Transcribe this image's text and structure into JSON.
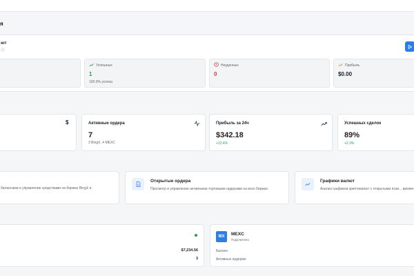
{
  "header": {
    "title_fragment": "я"
  },
  "bot_panel": {
    "title_fragment": "ют",
    "stats": [
      {
        "label": "Успешных",
        "value": "1",
        "sub": "100.0% успеха"
      },
      {
        "label": "Неудачных",
        "value": "0"
      },
      {
        "label": "Прибыль",
        "value": "$0.00"
      }
    ]
  },
  "kpis": [
    {
      "title": "Активные ордера",
      "value": "7",
      "sub": "3 BingX, 4 MEXC"
    },
    {
      "title": "Прибыль за 24ч",
      "value": "$342.18",
      "sub": "+12.4%"
    },
    {
      "title": "Успешных сделок",
      "value": "89%",
      "sub": "+2.3%"
    }
  ],
  "features": [
    {
      "desc": "балансами и управление средствами на биржах BingX и"
    },
    {
      "title": "Открытые ордера",
      "desc": "Просмотр и управление активными торговыми ордерами на всех биржах"
    },
    {
      "title": "Графики валют",
      "desc": "Анализ графиков криптовалют с открытыми пози... времени"
    }
  ],
  "exchanges": {
    "left": {
      "balance": "$7,234.56",
      "orders": "3"
    },
    "mexc": {
      "badge": "MX",
      "name": "MEXC",
      "status": "Подключено",
      "balance_label": "Баланс:",
      "orders_label": "Активных ордеров:"
    }
  },
  "colors": {
    "accent": "#2b7de9",
    "success": "#2e9e4a",
    "danger": "#d33b3b",
    "warning": "#e0892c"
  }
}
